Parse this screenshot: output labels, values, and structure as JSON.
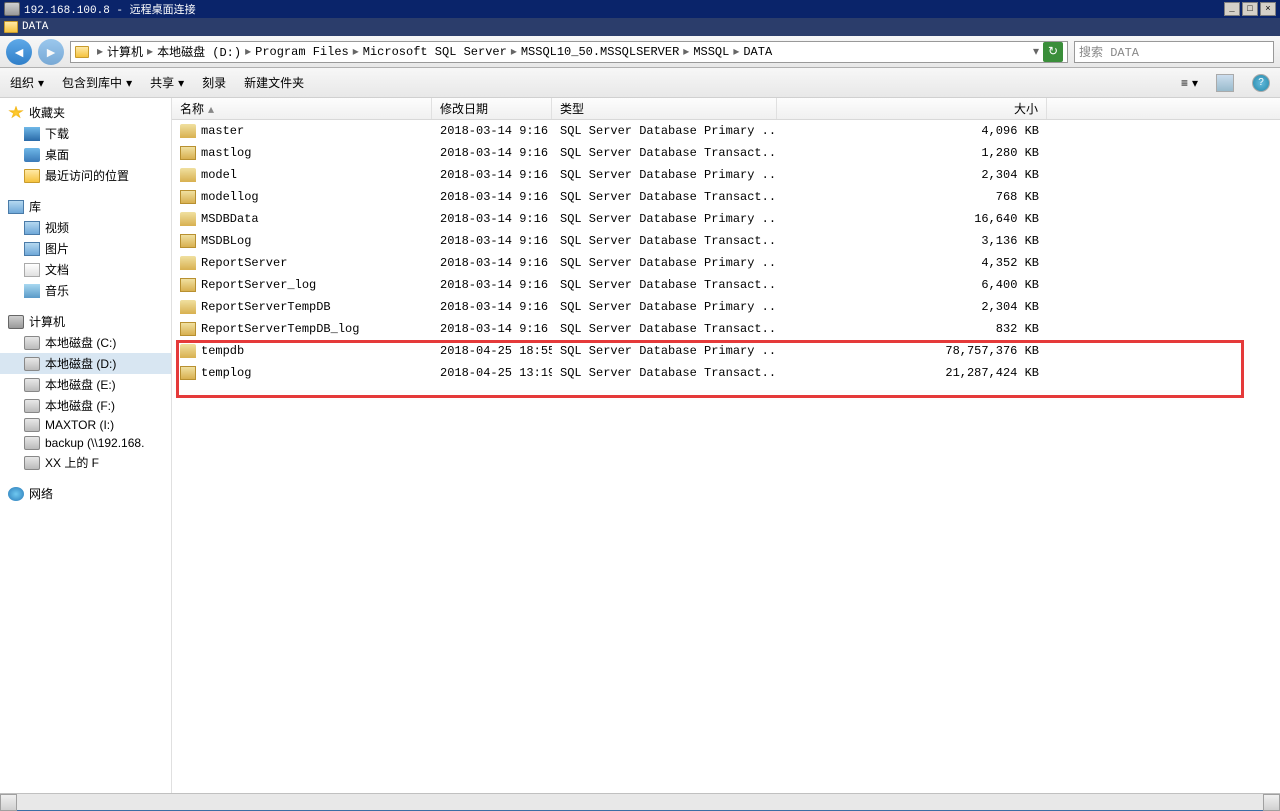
{
  "rdp": {
    "title": "192.168.100.8 - 远程桌面连接"
  },
  "explorer": {
    "title": "DATA"
  },
  "breadcrumb": {
    "root": "计算机",
    "parts": [
      "本地磁盘 (D:)",
      "Program Files",
      "Microsoft SQL Server",
      "MSSQL10_50.MSSQLSERVER",
      "MSSQL",
      "DATA"
    ]
  },
  "search": {
    "placeholder": "搜索 DATA"
  },
  "toolbar": {
    "organize": "组织",
    "include": "包含到库中",
    "share": "共享",
    "burn": "刻录",
    "newfolder": "新建文件夹"
  },
  "sidebar": {
    "favorites": {
      "label": "收藏夹",
      "items": [
        {
          "icon": "download",
          "label": "下载"
        },
        {
          "icon": "desktop",
          "label": "桌面"
        },
        {
          "icon": "folder",
          "label": "最近访问的位置"
        }
      ]
    },
    "libraries": {
      "label": "库",
      "items": [
        {
          "icon": "library",
          "label": "视频"
        },
        {
          "icon": "library",
          "label": "图片"
        },
        {
          "icon": "doc",
          "label": "文档"
        },
        {
          "icon": "music",
          "label": "音乐"
        }
      ]
    },
    "computer": {
      "label": "计算机",
      "items": [
        {
          "icon": "drive",
          "label": "本地磁盘 (C:)"
        },
        {
          "icon": "drive",
          "label": "本地磁盘 (D:)",
          "selected": true
        },
        {
          "icon": "drive",
          "label": "本地磁盘 (E:)"
        },
        {
          "icon": "drive",
          "label": "本地磁盘 (F:)"
        },
        {
          "icon": "drive",
          "label": "MAXTOR (I:)"
        },
        {
          "icon": "drive",
          "label": "backup (\\\\192.168."
        },
        {
          "icon": "drive",
          "label": "XX 上的 F"
        }
      ]
    },
    "network": {
      "label": "网络"
    }
  },
  "columns": {
    "name": "名称",
    "date": "修改日期",
    "type": "类型",
    "size": "大小"
  },
  "files": [
    {
      "icon": "db",
      "name": "master",
      "date": "2018-03-14 9:16",
      "type": "SQL Server Database Primary ...",
      "size": "4,096 KB"
    },
    {
      "icon": "dblog",
      "name": "mastlog",
      "date": "2018-03-14 9:16",
      "type": "SQL Server Database Transact...",
      "size": "1,280 KB"
    },
    {
      "icon": "db",
      "name": "model",
      "date": "2018-03-14 9:16",
      "type": "SQL Server Database Primary ...",
      "size": "2,304 KB"
    },
    {
      "icon": "dblog",
      "name": "modellog",
      "date": "2018-03-14 9:16",
      "type": "SQL Server Database Transact...",
      "size": "768 KB"
    },
    {
      "icon": "db",
      "name": "MSDBData",
      "date": "2018-03-14 9:16",
      "type": "SQL Server Database Primary ...",
      "size": "16,640 KB"
    },
    {
      "icon": "dblog",
      "name": "MSDBLog",
      "date": "2018-03-14 9:16",
      "type": "SQL Server Database Transact...",
      "size": "3,136 KB"
    },
    {
      "icon": "db",
      "name": "ReportServer",
      "date": "2018-03-14 9:16",
      "type": "SQL Server Database Primary ...",
      "size": "4,352 KB"
    },
    {
      "icon": "dblog",
      "name": "ReportServer_log",
      "date": "2018-03-14 9:16",
      "type": "SQL Server Database Transact...",
      "size": "6,400 KB"
    },
    {
      "icon": "db",
      "name": "ReportServerTempDB",
      "date": "2018-03-14 9:16",
      "type": "SQL Server Database Primary ...",
      "size": "2,304 KB"
    },
    {
      "icon": "dblog",
      "name": "ReportServerTempDB_log",
      "date": "2018-03-14 9:16",
      "type": "SQL Server Database Transact...",
      "size": "832 KB"
    },
    {
      "icon": "db",
      "name": "tempdb",
      "date": "2018-04-25 18:55",
      "type": "SQL Server Database Primary ...",
      "size": "78,757,376 KB",
      "hl": true
    },
    {
      "icon": "dblog",
      "name": "templog",
      "date": "2018-04-25 13:19",
      "type": "SQL Server Database Transact...",
      "size": "21,287,424 KB",
      "hl": true
    }
  ]
}
